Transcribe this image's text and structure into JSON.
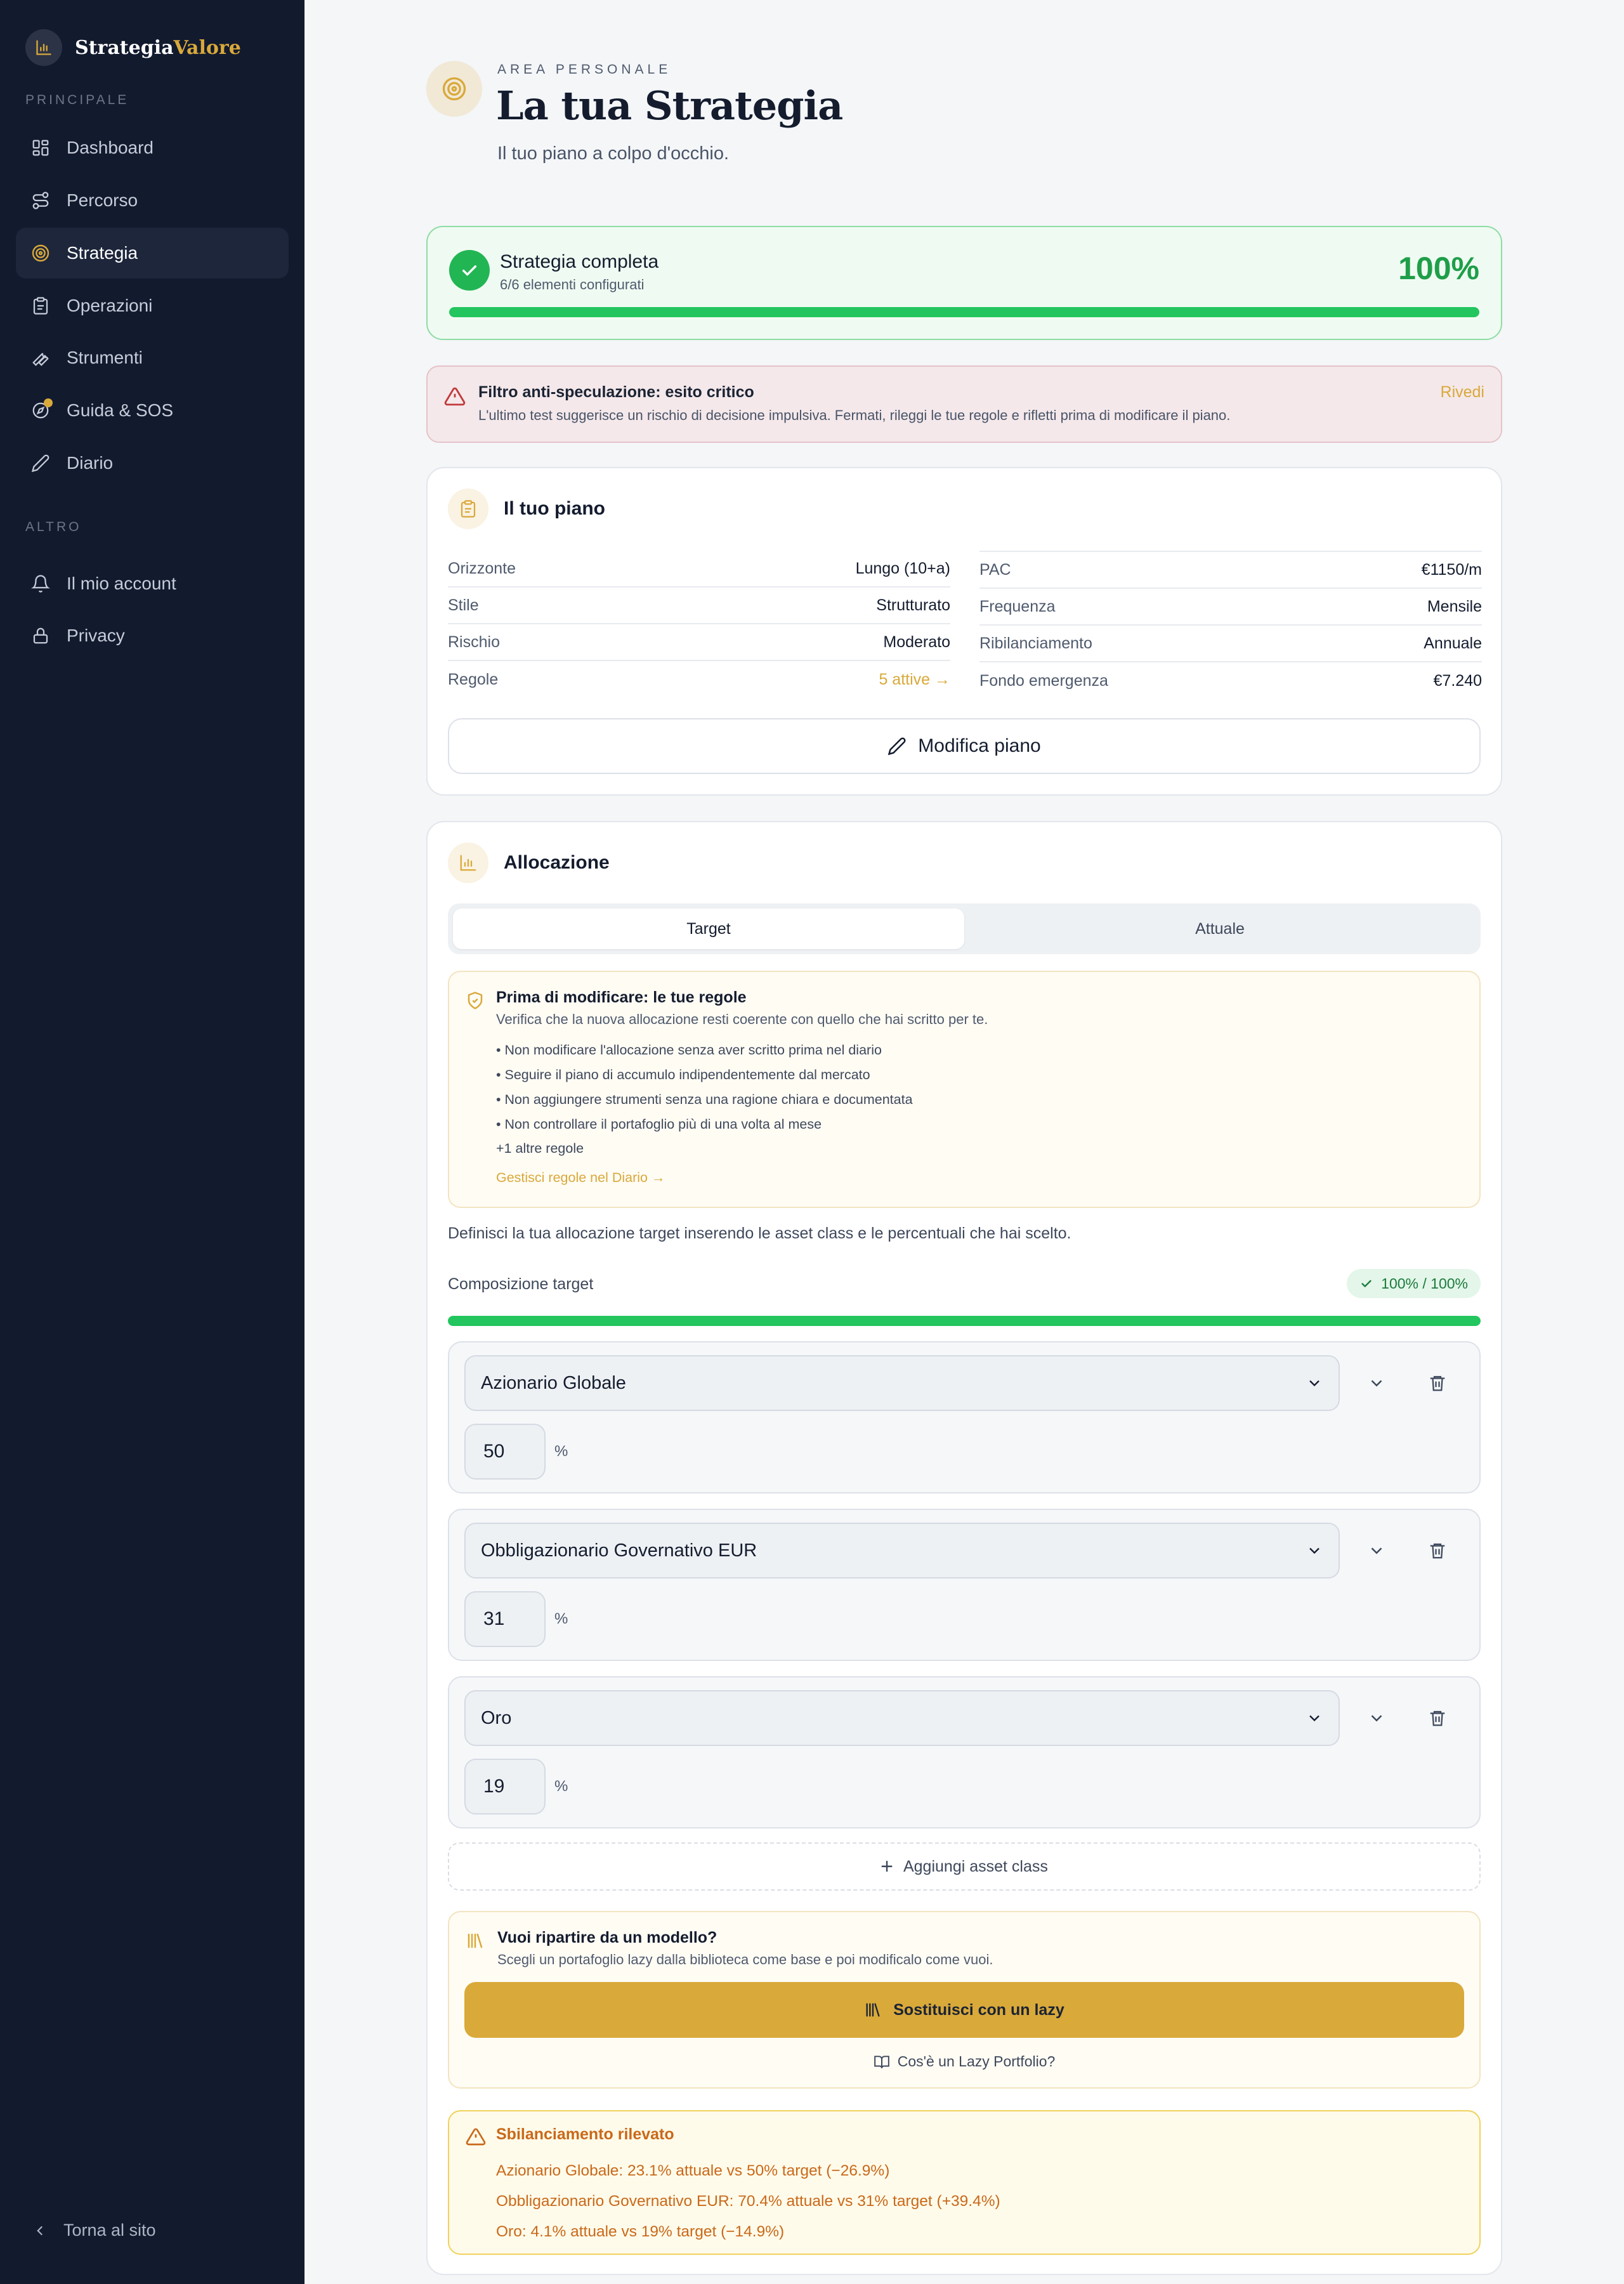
{
  "brand": {
    "name_part1": "Strategia",
    "name_part2": "Valore"
  },
  "sidebar": {
    "section_main": "PRINCIPALE",
    "section_other": "ALTRO",
    "main_items": [
      {
        "label": "Dashboard",
        "icon": "grid-icon"
      },
      {
        "label": "Percorso",
        "icon": "route-icon"
      },
      {
        "label": "Strategia",
        "icon": "target-icon",
        "active": true
      },
      {
        "label": "Operazioni",
        "icon": "clipboard-icon"
      },
      {
        "label": "Strumenti",
        "icon": "wrench-icon"
      },
      {
        "label": "Guida & SOS",
        "icon": "compass-icon"
      },
      {
        "label": "Diario",
        "icon": "pencil-icon"
      }
    ],
    "other_items": [
      {
        "label": "Il mio account",
        "icon": "bell-icon"
      },
      {
        "label": "Privacy",
        "icon": "lock-icon"
      }
    ],
    "back_link": "Torna al sito"
  },
  "header": {
    "eyebrow": "AREA PERSONALE",
    "title": "La tua Strategia",
    "subtitle": "Il tuo piano a colpo d'occhio."
  },
  "completion": {
    "title": "Strategia completa",
    "subtitle": "6/6 elementi configurati",
    "percent_label": "100%",
    "progress": 1.0
  },
  "alert": {
    "title": "Filtro anti-speculazione: esito critico",
    "text": "L'ultimo test suggerisce un rischio di decisione impulsiva. Fermati, rileggi le tue regole e rifletti prima di modificare il piano.",
    "action": "Rivedi"
  },
  "plan": {
    "title": "Il tuo piano",
    "left": [
      {
        "key": "Orizzonte",
        "value": "Lungo (10+a)"
      },
      {
        "key": "Stile",
        "value": "Strutturato"
      },
      {
        "key": "Rischio",
        "value": "Moderato"
      },
      {
        "key": "Regole",
        "value": "5 attive →"
      }
    ],
    "right": [
      {
        "key": "PAC",
        "value": "€1150/m"
      },
      {
        "key": "Frequenza",
        "value": "Mensile"
      },
      {
        "key": "Ribilanciamento",
        "value": "Annuale"
      },
      {
        "key": "Fondo emergenza",
        "value": "€7.240"
      }
    ],
    "edit_button": "Modifica piano"
  },
  "allocation": {
    "title": "Allocazione",
    "tabs": [
      {
        "label": "Target",
        "active": true
      },
      {
        "label": "Attuale",
        "active": false
      }
    ],
    "rules": {
      "title": "Prima di modificare: le tue regole",
      "subtitle": "Verifica che la nuova allocazione resti coerente con quello che hai scritto per te.",
      "items": [
        "• Non modificare l'allocazione senza aver scritto prima nel diario",
        "• Seguire il piano di accumulo indipendentemente dal mercato",
        "• Non aggiungere strumenti senza una ragione chiara e documentata",
        "• Non controllare il portafoglio più di una volta al mese"
      ],
      "more": "+1 altre regole",
      "link": "Gestisci regole nel Diario →"
    },
    "hint": "Definisci la tua allocazione target inserendo le asset class e le percentuali che hai scelto.",
    "composition_label": "Composizione target",
    "composition_badge": "100% / 100%",
    "composition_progress": 1.0,
    "percent_sign": "%",
    "assets": [
      {
        "name": "Azionario Globale",
        "percent": "50"
      },
      {
        "name": "Obbligazionario Governativo EUR",
        "percent": "31"
      },
      {
        "name": "Oro",
        "percent": "19"
      }
    ],
    "add_button": "Aggiungi asset class",
    "model": {
      "title": "Vuoi ripartire da un modello?",
      "subtitle": "Scegli un portafoglio lazy dalla biblioteca come base e poi modificalo come vuoi.",
      "button": "Sostituisci con un lazy",
      "link": "Cos'è un Lazy Portfolio?"
    },
    "imbalance": {
      "title": "Sbilanciamento rilevato",
      "lines": [
        "Azionario Globale: 23.1% attuale vs 50% target (−26.9%)",
        "Obbligazionario Governativo EUR: 70.4% attuale vs 31% target (+39.4%)",
        "Oro: 4.1% attuale vs 19% target (−14.9%)"
      ]
    }
  },
  "colors": {
    "accent": "#d9a93a",
    "success": "#22c55e",
    "sidebar": "#121a2e",
    "warning": "#c9691a"
  }
}
